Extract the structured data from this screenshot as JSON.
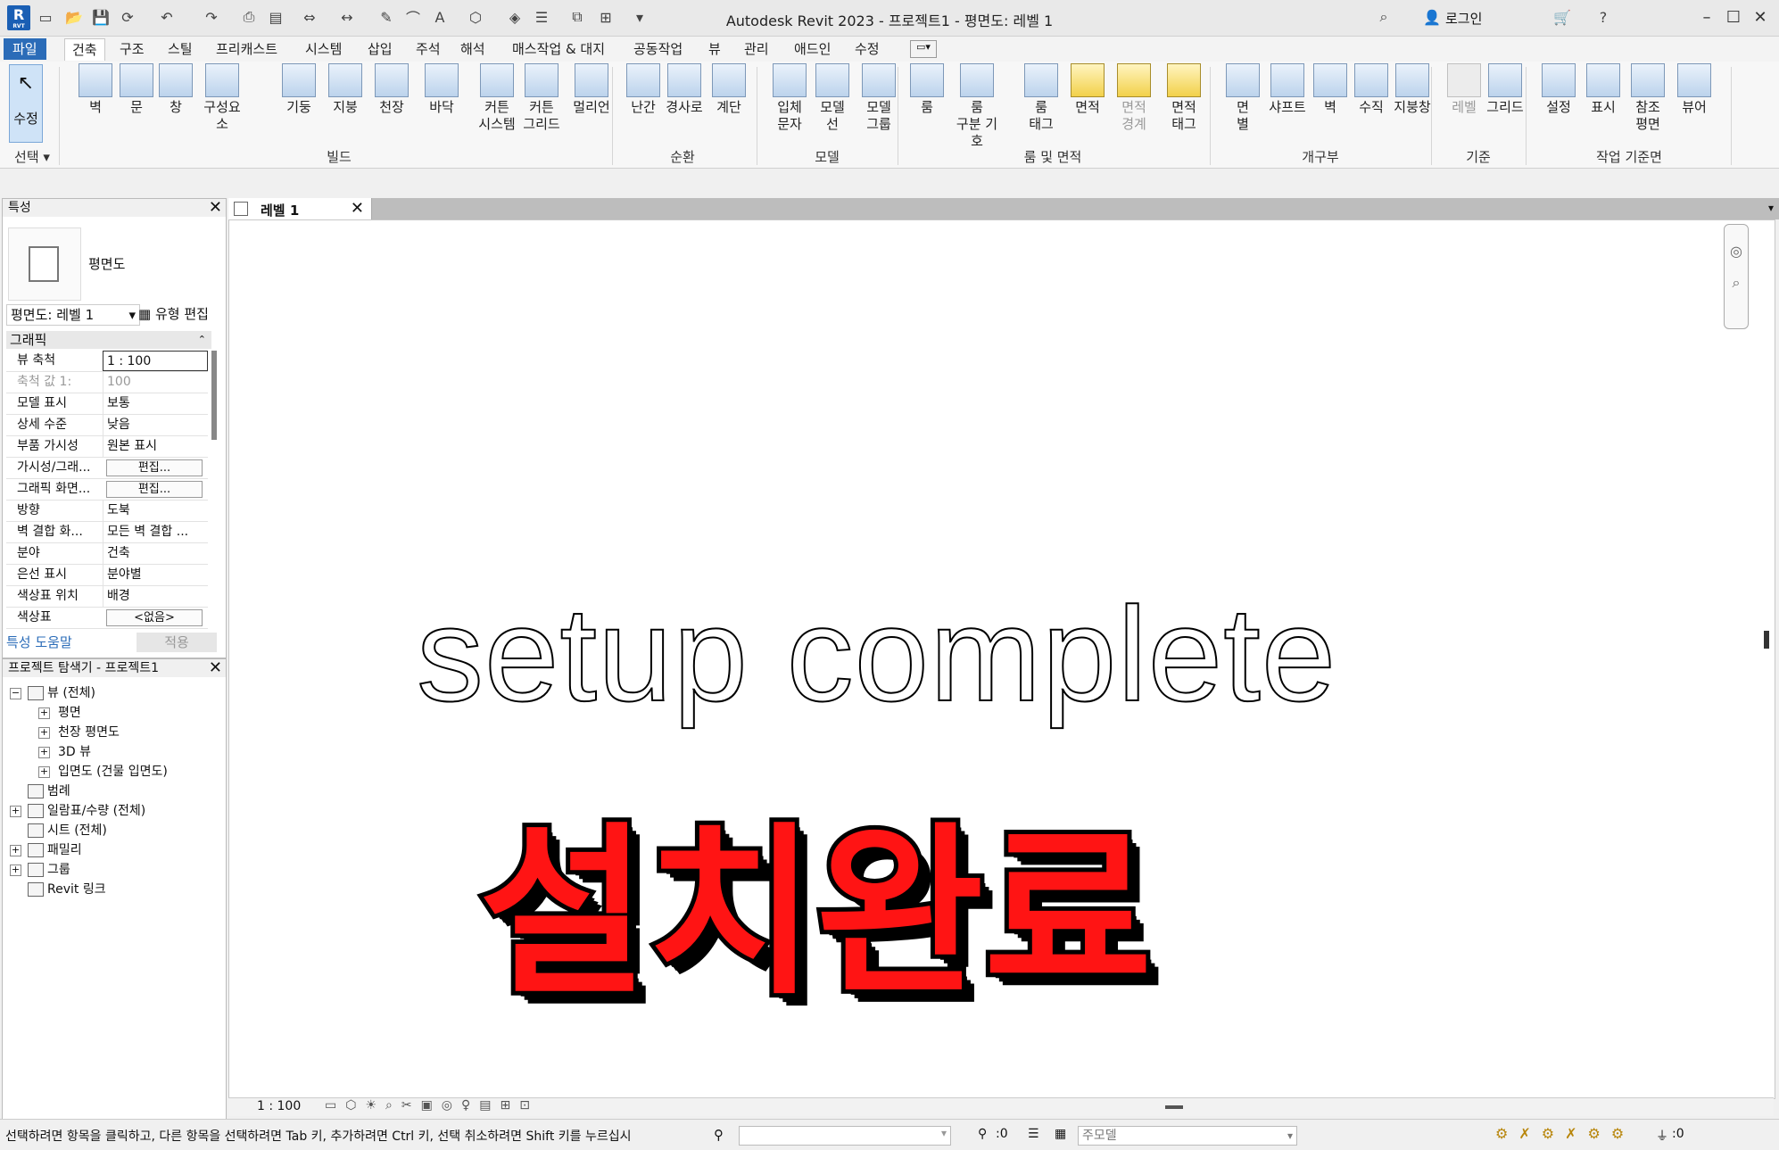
{
  "app": {
    "title": "Autodesk Revit 2023 - 프로젝트1 - 평면도: 레벨 1",
    "logo_text": "R",
    "logo_sub": "RVT",
    "login": "로그인"
  },
  "menu": {
    "file": "파일",
    "tabs": [
      "건축",
      "구조",
      "스틸",
      "프리캐스트",
      "시스템",
      "삽입",
      "주석",
      "해석",
      "매스작업 & 대지",
      "공동작업",
      "뷰",
      "관리",
      "애드인",
      "수정"
    ],
    "active": "건축"
  },
  "ribbon": {
    "select_label": "수정",
    "select_group": "선택",
    "build": [
      "벽",
      "문",
      "창",
      "구성요소",
      "기둥",
      "지붕",
      "천장",
      "바닥",
      "커튼\n시스템",
      "커튼\n그리드",
      "멀리언"
    ],
    "build_group": "빌드",
    "circulation": [
      "난간",
      "경사로",
      "계단"
    ],
    "circulation_group": "순환",
    "model": [
      "입체\n문자",
      "모델\n선",
      "모델\n그룹"
    ],
    "model_group": "모델",
    "room": [
      "룸",
      "룸\n구분 기호",
      "룸\n태그",
      "면적",
      "면적\n경계",
      "면적\n태그"
    ],
    "room_group": "룸 및 면적",
    "opening": [
      "면\n별",
      "샤프트",
      "벽",
      "수직",
      "지붕창"
    ],
    "opening_group": "개구부",
    "datum": [
      "레벨",
      "그리드"
    ],
    "datum_group": "기준",
    "workplane": [
      "설정",
      "표시",
      "참조\n평면",
      "뷰어"
    ],
    "workplane_group": "작업 기준면"
  },
  "properties": {
    "header": "특성",
    "type_name": "평면도",
    "selector": "평면도: 레벨 1",
    "edit_type": "유형 편집",
    "section": "그래픽",
    "rows": [
      {
        "k": "뷰 축척",
        "v": "1 : 100",
        "kind": "input"
      },
      {
        "k": "축척 값    1:",
        "v": "100",
        "kind": "gray"
      },
      {
        "k": "모델 표시",
        "v": "보통",
        "kind": "text"
      },
      {
        "k": "상세 수준",
        "v": "낮음",
        "kind": "text"
      },
      {
        "k": "부품 가시성",
        "v": "원본 표시",
        "kind": "text"
      },
      {
        "k": "가시성/그래...",
        "v": "편집...",
        "kind": "button"
      },
      {
        "k": "그래픽 화면...",
        "v": "편집...",
        "kind": "button"
      },
      {
        "k": "방향",
        "v": "도북",
        "kind": "text"
      },
      {
        "k": "벽 결합 화...",
        "v": "모든 벽 결합 ...",
        "kind": "text"
      },
      {
        "k": "분야",
        "v": "건축",
        "kind": "text"
      },
      {
        "k": "은선 표시",
        "v": "분야별",
        "kind": "text"
      },
      {
        "k": "색상표 위치",
        "v": "배경",
        "kind": "text"
      },
      {
        "k": "색상표",
        "v": "<없음>",
        "kind": "button"
      }
    ],
    "help": "특성 도움말",
    "apply": "적용"
  },
  "browser": {
    "header": "프로젝트 탐색기 - 프로젝트1",
    "items": [
      {
        "label": "뷰 (전체)",
        "level": 0,
        "exp": "-"
      },
      {
        "label": "평면",
        "level": 1,
        "exp": "+"
      },
      {
        "label": "천장 평면도",
        "level": 1,
        "exp": "+"
      },
      {
        "label": "3D 뷰",
        "level": 1,
        "exp": "+"
      },
      {
        "label": "입면도 (건물 입면도)",
        "level": 1,
        "exp": "+"
      },
      {
        "label": "범례",
        "level": 0,
        "exp": ""
      },
      {
        "label": "일람표/수량 (전체)",
        "level": 0,
        "exp": "+"
      },
      {
        "label": "시트 (전체)",
        "level": 0,
        "exp": ""
      },
      {
        "label": "패밀리",
        "level": 0,
        "exp": "+"
      },
      {
        "label": "그룹",
        "level": 0,
        "exp": "+"
      },
      {
        "label": "Revit 링크",
        "level": 0,
        "exp": ""
      }
    ]
  },
  "view": {
    "tab_label": "레벨 1",
    "overlay_en": "setup complete",
    "overlay_ko": "설치완료",
    "scale": "1 : 100"
  },
  "status": {
    "message": "선택하려면 항목을 클릭하고, 다른 항목을 선택하려면 Tab 키, 추가하려면 Ctrl 키, 선택 취소하려면 Shift 키를 누르십시",
    "count": ":0",
    "model": "주모델",
    "filter": ":0"
  },
  "colors": {
    "accent": "#2b6cb8",
    "overlay_red": "#ff1414"
  }
}
